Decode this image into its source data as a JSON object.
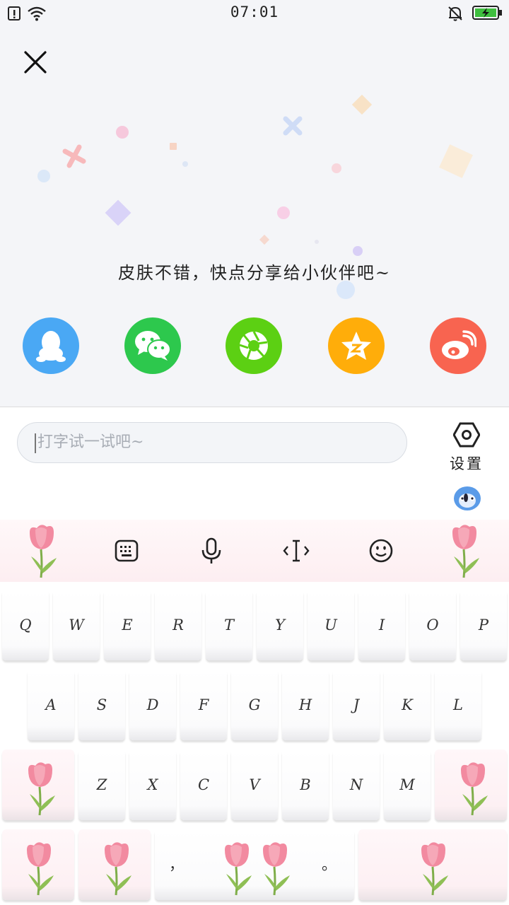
{
  "status_bar": {
    "time": "07:01"
  },
  "share": {
    "message": "皮肤不错，快点分享给小伙伴吧~",
    "targets": [
      {
        "icon": "qq-icon",
        "color": "#4aa8f4"
      },
      {
        "icon": "wechat-icon",
        "color": "#2dc84d"
      },
      {
        "icon": "moments-icon",
        "color": "#5cd013"
      },
      {
        "icon": "qzone-icon",
        "color": "#ffad0a"
      },
      {
        "icon": "weibo-icon",
        "color": "#f86450"
      }
    ]
  },
  "input": {
    "placeholder": "打字试一试吧~"
  },
  "settings": {
    "label": "设置"
  },
  "keyboard": {
    "row1": [
      "Q",
      "W",
      "E",
      "R",
      "T",
      "Y",
      "U",
      "I",
      "O",
      "P"
    ],
    "row2": [
      "A",
      "S",
      "D",
      "F",
      "G",
      "H",
      "J",
      "K",
      "L"
    ],
    "row3": [
      "Z",
      "X",
      "C",
      "V",
      "B",
      "N",
      "M"
    ],
    "row4": {
      "comma": "，",
      "period": "。"
    }
  }
}
